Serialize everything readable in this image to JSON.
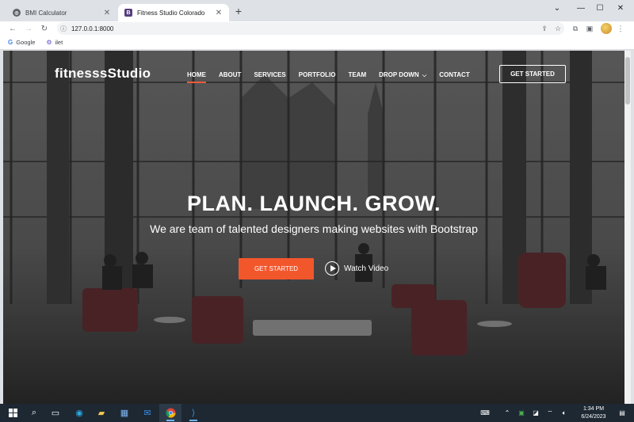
{
  "browser": {
    "tabs": [
      {
        "title": "BMI Calculator",
        "favicon": "globe-icon",
        "active": false
      },
      {
        "title": "Fitness Studio Colorado",
        "favicon": "bootstrap-icon",
        "active": true
      }
    ],
    "url": "127.0.0.1:8000",
    "bookmarks": [
      {
        "label": "Google",
        "icon": "google-icon"
      },
      {
        "label": "ilet",
        "icon": "ilet-icon"
      }
    ]
  },
  "site": {
    "brand": "fitnesssStudio",
    "nav": [
      "HOME",
      "ABOUT",
      "SERVICES",
      "PORTFOLIO",
      "TEAM",
      "DROP DOWN",
      "CONTACT"
    ],
    "active_nav": "HOME",
    "cta": "GET STARTED"
  },
  "hero": {
    "headline": "PLAN. LAUNCH. GROW.",
    "subline": "We are team of talented designers making websites with Bootstrap",
    "primary_button": "GET STARTED",
    "video_button": "Watch Video"
  },
  "taskbar": {
    "time": "1:34 PM",
    "date": "6/24/2023"
  },
  "colors": {
    "accent": "#f2572c",
    "active_underline": "#ee5b3a",
    "taskbar": "#1d2833"
  }
}
